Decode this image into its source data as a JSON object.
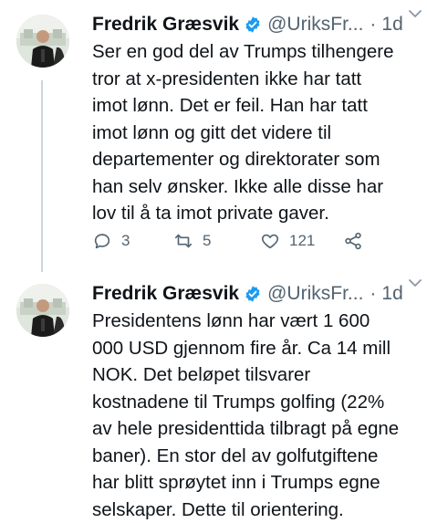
{
  "tweets": [
    {
      "name": "Fredrik Græsvik",
      "handle": "@UriksFr...",
      "separator": "·",
      "time": "1d",
      "lines": [
        "Ser en god del av Trumps tilhengere",
        "tror at x-presidenten ikke har tatt",
        "imot lønn. Det er feil. Han har tatt",
        "imot lønn og gitt det videre til",
        "departementer og direktorater som",
        "han selv ønsker. Ikke alle disse har",
        "lov til å ta imot private gaver."
      ],
      "replies": "3",
      "retweets": "5",
      "likes": "121"
    },
    {
      "name": "Fredrik Græsvik",
      "handle": "@UriksFr...",
      "separator": "·",
      "time": "1d",
      "lines": [
        "Presidentens lønn har vært 1 600",
        "000 USD gjennom fire år. Ca 14 mill",
        "NOK. Det beløpet tilsvarer",
        "kostnadene til Trumps golfing (22%",
        "av hele presidenttida tilbragt på egne",
        "baner). En stor del av golfutgiftene",
        "har blitt sprøytet inn i Trumps egne",
        "selskaper. Dette til orientering."
      ]
    }
  ],
  "colors": {
    "verified": "#1d9bf0",
    "secondary_text": "#536471",
    "thread_line": "#ccd6dd"
  },
  "icons": [
    "reply-icon",
    "retweet-icon",
    "like-icon",
    "share-icon",
    "verified-badge-icon",
    "caret-down-icon"
  ]
}
